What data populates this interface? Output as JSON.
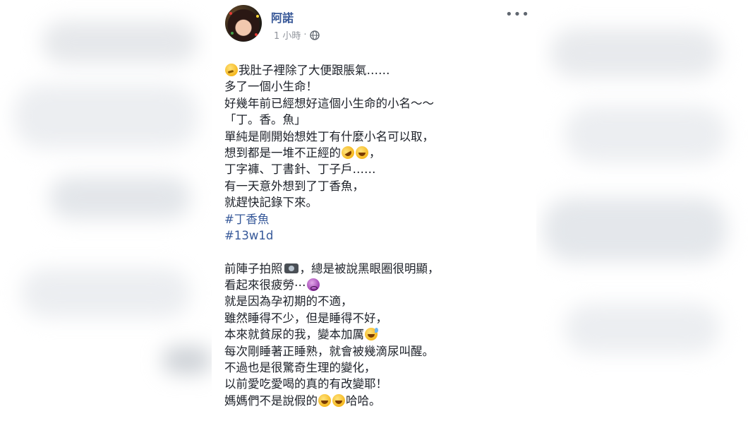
{
  "post": {
    "author": "阿諾",
    "time": "1 小時",
    "privacy_icon": "globe-icon",
    "more_icon": "more-options-icon",
    "more_label": "•••"
  },
  "text": {
    "p1": {
      "l1_emoji": "thinking-face",
      "l1": "我肚子裡除了大便跟脹氣……",
      "l2": "多了一個小生命！",
      "l3": "好幾年前已經想好這個小生命的小名～～",
      "l4": "「丁。香。魚」",
      "l5": "單純是剛開始想姓丁有什麼小名可以取，",
      "l6": "想到都是一堆不正經的",
      "l6_emoji1": "rolling-on-floor-laughing",
      "l6_emoji2": "face-with-tears-of-joy",
      "l6_end": "，",
      "l7": "丁字褲、丁書針、丁子戶……",
      "l8": "有一天意外想到了丁香魚，",
      "l9": "就趕快記錄下來。",
      "hashtag1": "#丁香魚",
      "hashtag2": "#13w1d"
    },
    "p2": {
      "l1a": "前陣子拍照",
      "l1_icon": "camera",
      "l1b": "，總是被說黑眼圈很明顯，",
      "l2": "看起來很疲勞⋯",
      "l2_emoji": "dizzy-face",
      "l3": "就是因為孕初期的不適，",
      "l4": "雖然睡得不少，但是睡得不好，",
      "l5": "本來就貧尿的我，變本加厲",
      "l5_emoji": "grinning-face-with-sweat",
      "l6": "每次剛睡著正睡熟，就會被幾滴尿叫醒。",
      "l7": "不過也是很驚奇生理的變化，",
      "l8": "以前愛吃愛喝的真的有改變耶！",
      "l9a": "媽媽們不是說假的",
      "l9_emoji1": "grinning-squinting-face",
      "l9_emoji2": "grinning-squinting-face",
      "l9b": "哈哈。"
    }
  },
  "colors": {
    "author": "#385898",
    "hashtag": "#365899",
    "meta": "#90949c",
    "body_text": "#1d2129"
  }
}
